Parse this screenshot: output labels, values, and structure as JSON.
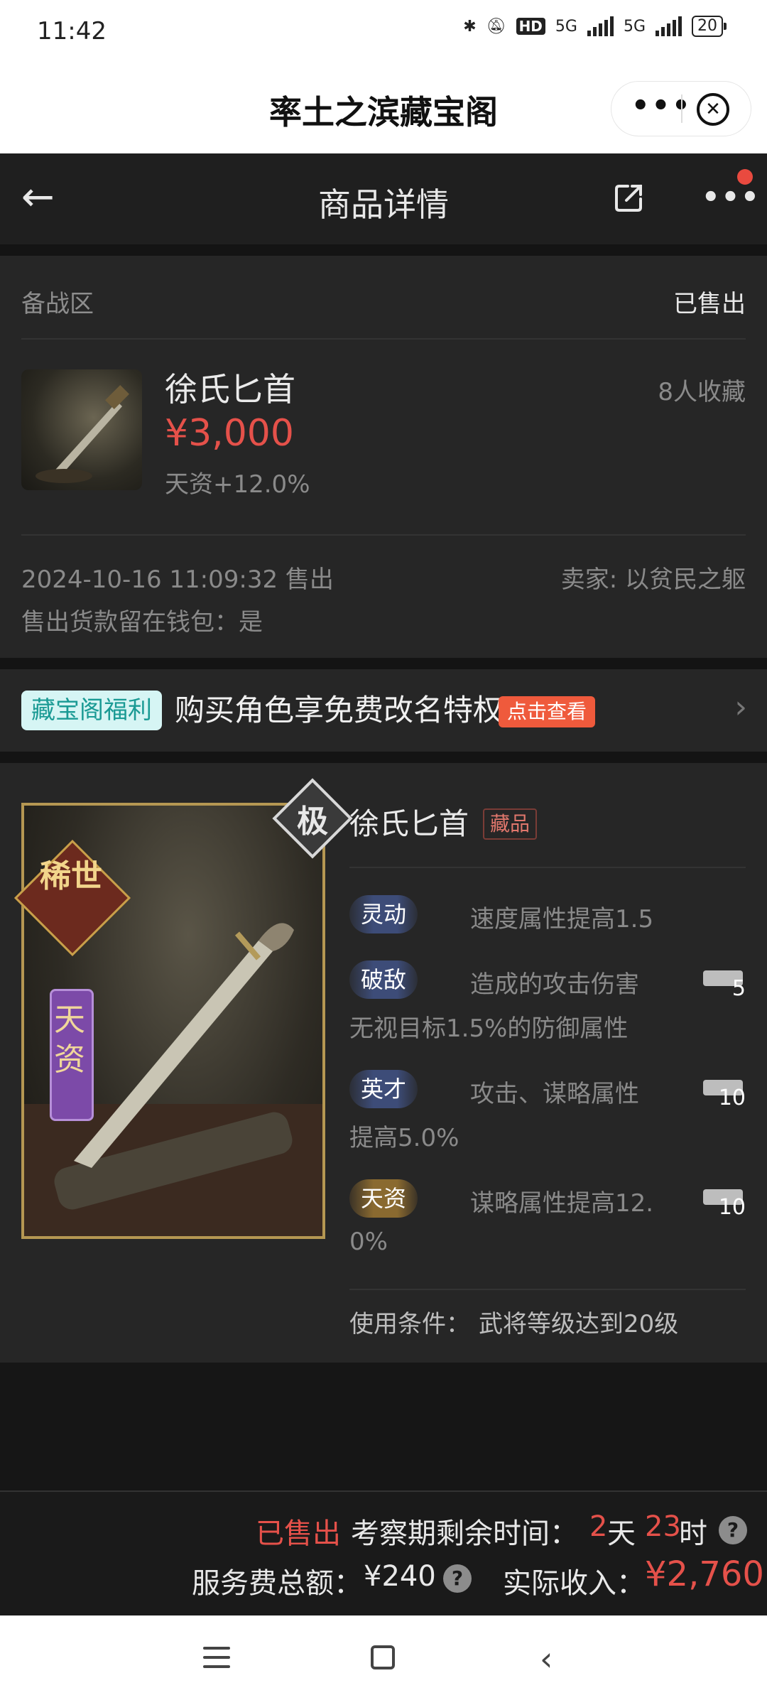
{
  "status_bar": {
    "time": "11:42",
    "network_label": "5G",
    "hd_label": "HD",
    "battery": "20"
  },
  "mini_program": {
    "title": "率土之滨藏宝阁"
  },
  "nav": {
    "title": "商品详情"
  },
  "listing": {
    "zone": "备战区",
    "status": "已售出",
    "name": "徐氏匕首",
    "favorites": "8人收藏",
    "price": "¥3,000",
    "attribute": "天资+12.0%",
    "sold_time": "2024-10-16 11:09:32 售出",
    "seller": "卖家: 以贫民之躯",
    "wallet_note": "售出货款留在钱包：是"
  },
  "promo": {
    "badge": "藏宝阁福利",
    "text": "购买角色享免费改名特权",
    "button": "点击查看"
  },
  "detail": {
    "grade": "极",
    "rarity": "稀世",
    "talent_tag": "天资",
    "name": "徐氏匕首",
    "collect_tag": "藏品",
    "skills": [
      {
        "name": "灵动",
        "desc_line1": "速度属性提高1.5",
        "desc_line2": "",
        "level": ""
      },
      {
        "name": "破敌",
        "desc_line1": "造成的攻击伤害",
        "desc_line2": "无视目标1.5%的防御属性",
        "level": "5"
      },
      {
        "name": "英才",
        "desc_line1": "攻击、谋略属性",
        "desc_line2": "提高5.0%",
        "level": "10"
      },
      {
        "name": "天资",
        "desc_line1": "谋略属性提高12.",
        "desc_line2": "0%",
        "level": "10"
      }
    ],
    "condition_label": "使用条件：",
    "condition_value": "武将等级达到20级"
  },
  "bottom": {
    "sold": "已售出",
    "period_label": "考察期剩余时间：",
    "days": "2",
    "days_unit": "天",
    "hours": "23",
    "hours_unit": "时",
    "fee_label": "服务费总额：",
    "fee_value": "¥240",
    "income_label": "实际收入：",
    "income_value": "¥2,760"
  }
}
